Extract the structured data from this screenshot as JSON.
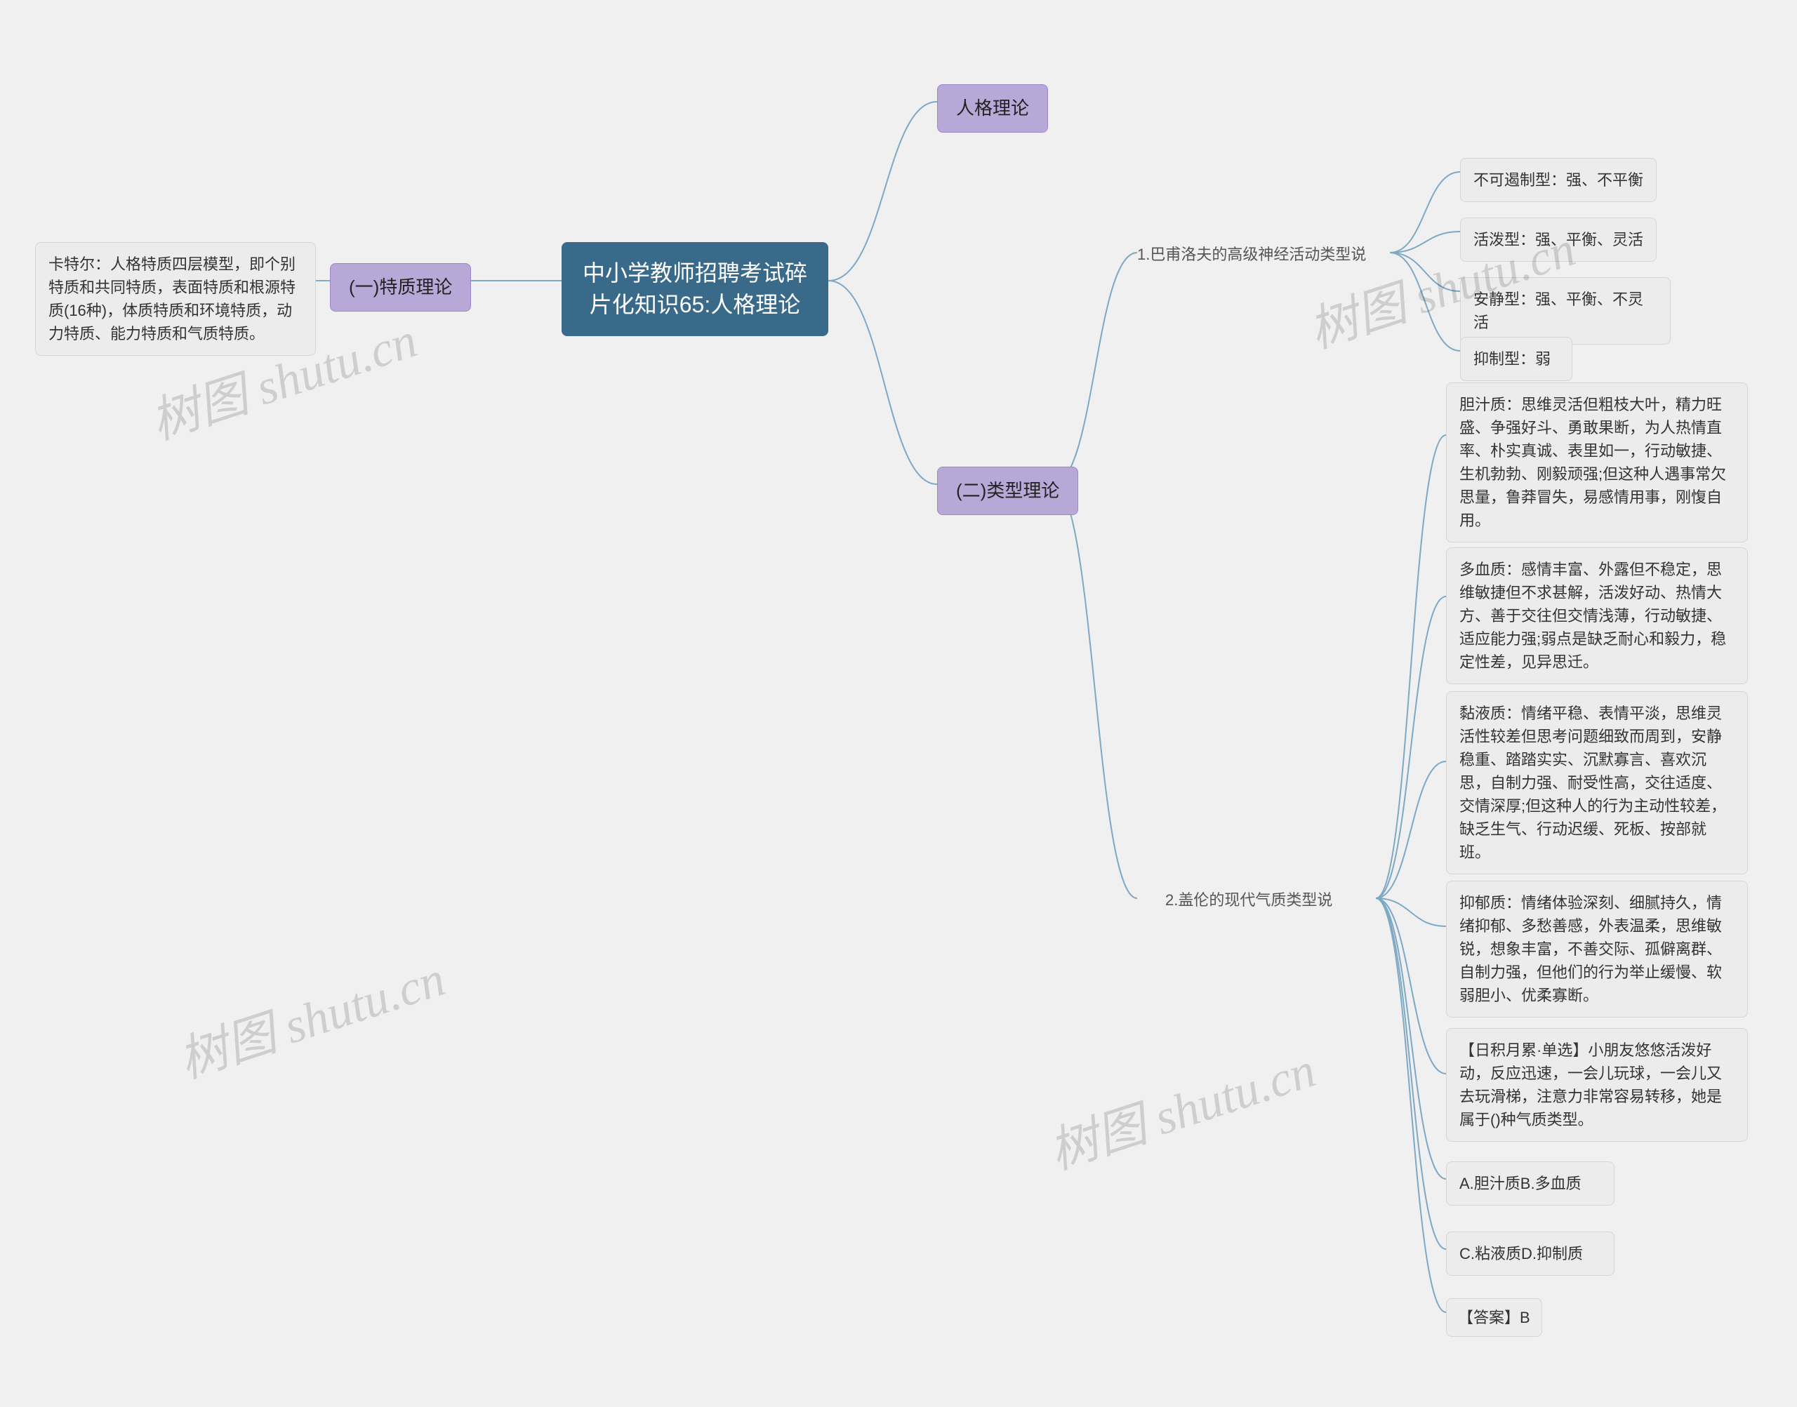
{
  "root": {
    "title": "中小学教师招聘考试碎片化知识65:人格理论"
  },
  "left": {
    "branch1": {
      "label": "(一)特质理论",
      "leaf": "卡特尔：人格特质四层模型，即个别特质和共同特质，表面特质和根源特质(16种)，体质特质和环境特质，动力特质、能力特质和气质特质。"
    }
  },
  "right": {
    "branch1": {
      "label": "人格理论"
    },
    "branch2": {
      "label": "(二)类型理论",
      "sub1": {
        "label": "1.巴甫洛夫的高级神经活动类型说",
        "items": [
          "不可遏制型：强、不平衡",
          "活泼型：强、平衡、灵活",
          "安静型：强、平衡、不灵活",
          "抑制型：弱"
        ]
      },
      "sub2": {
        "label": "2.盖伦的现代气质类型说",
        "items": [
          "胆汁质：思维灵活但粗枝大叶，精力旺盛、争强好斗、勇敢果断，为人热情直率、朴实真诚、表里如一，行动敏捷、生机勃勃、刚毅顽强;但这种人遇事常欠思量，鲁莽冒失，易感情用事，刚愎自用。",
          "多血质：感情丰富、外露但不稳定，思维敏捷但不求甚解，活泼好动、热情大方、善于交往但交情浅薄，行动敏捷、适应能力强;弱点是缺乏耐心和毅力，稳定性差，见异思迁。",
          "黏液质：情绪平稳、表情平淡，思维灵活性较差但思考问题细致而周到，安静稳重、踏踏实实、沉默寡言、喜欢沉思，自制力强、耐受性高，交往适度、交情深厚;但这种人的行为主动性较差，缺乏生气、行动迟缓、死板、按部就班。",
          "抑郁质：情绪体验深刻、细腻持久，情绪抑郁、多愁善感，外表温柔，思维敏锐，想象丰富，不善交际、孤僻离群、自制力强，但他们的行为举止缓慢、软弱胆小、优柔寡断。",
          "【日积月累·单选】小朋友悠悠活泼好动，反应迅速，一会儿玩球，一会儿又去玩滑梯，注意力非常容易转移，她是属于()种气质类型。",
          "A.胆汁质B.多血质",
          "C.粘液质D.抑制质",
          "【答案】B"
        ]
      }
    }
  },
  "watermark": "树图 shutu.cn"
}
